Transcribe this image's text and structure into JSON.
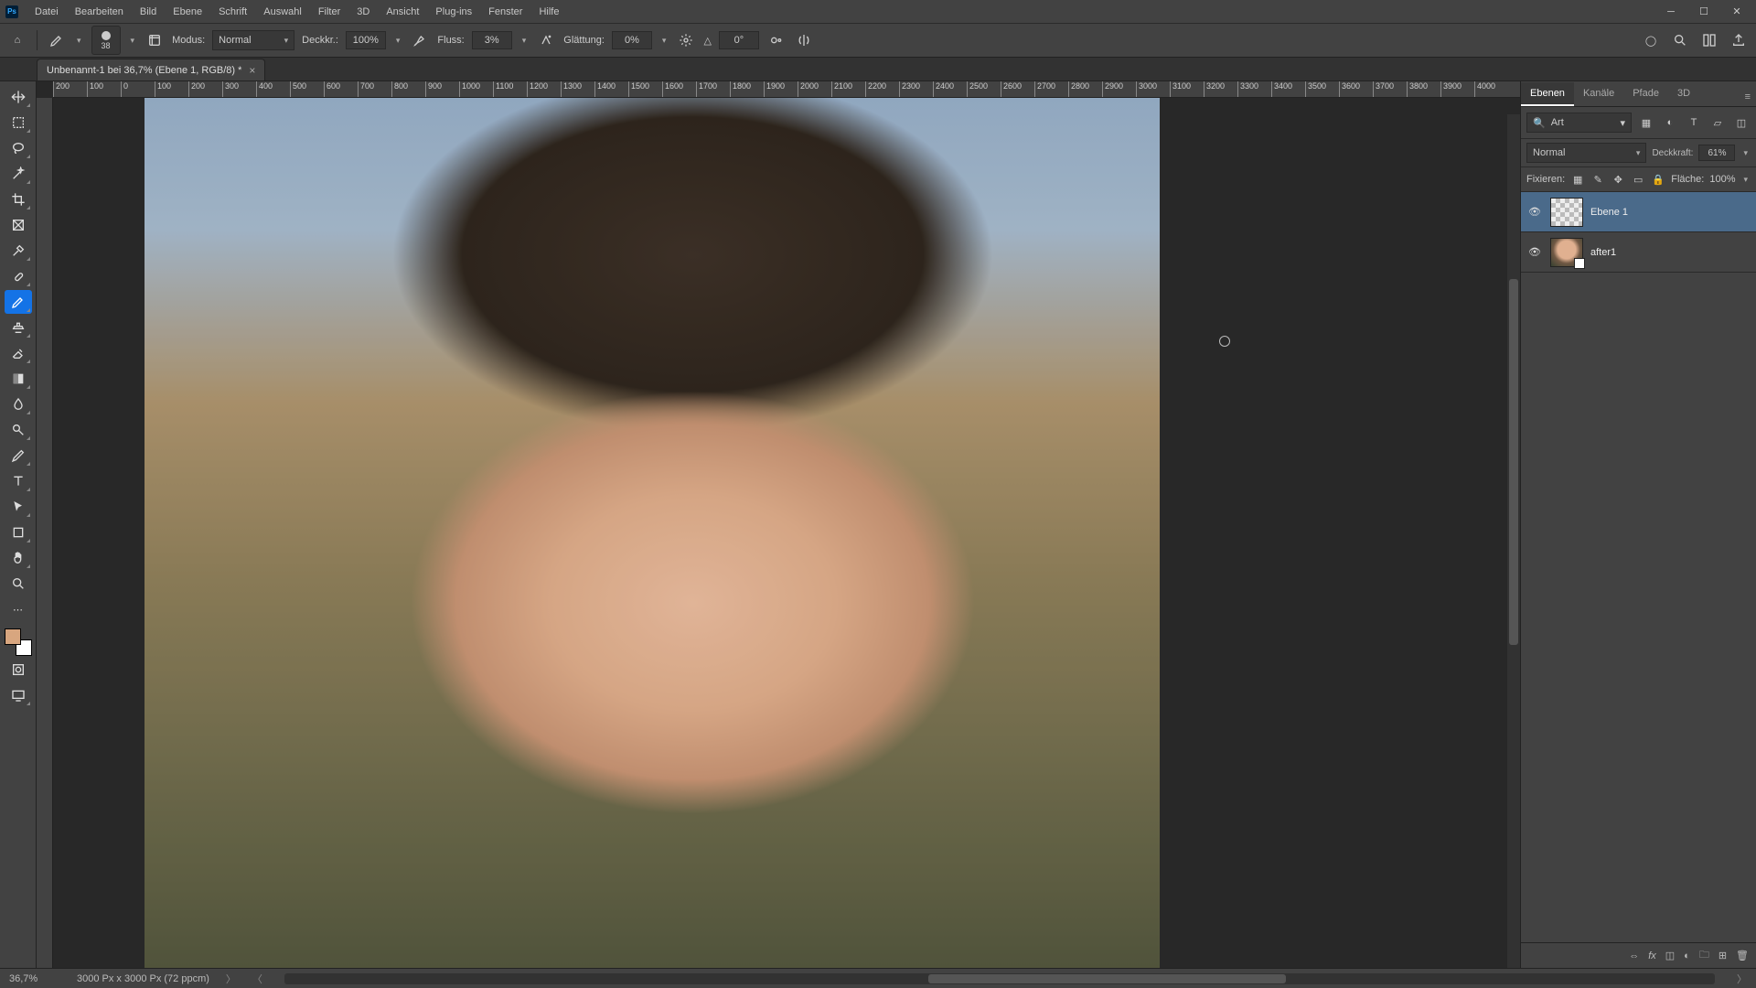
{
  "app": {
    "ps_badge": "Ps"
  },
  "menu": [
    "Datei",
    "Bearbeiten",
    "Bild",
    "Ebene",
    "Schrift",
    "Auswahl",
    "Filter",
    "3D",
    "Ansicht",
    "Plug-ins",
    "Fenster",
    "Hilfe"
  ],
  "options": {
    "brush_size": "38",
    "modus_label": "Modus:",
    "modus_value": "Normal",
    "deckkraft_label": "Deckkr.:",
    "deckkraft_value": "100%",
    "fluss_label": "Fluss:",
    "fluss_value": "3%",
    "glaettung_label": "Glättung:",
    "glaettung_value": "0%",
    "angle_icon": "△",
    "angle_value": "0°"
  },
  "document": {
    "tab_title": "Unbenannt-1 bei 36,7% (Ebene 1, RGB/8) *"
  },
  "ruler_ticks": [
    "200",
    "100",
    "0",
    "100",
    "200",
    "300",
    "400",
    "500",
    "600",
    "700",
    "800",
    "900",
    "1000",
    "1100",
    "1200",
    "1300",
    "1400",
    "1500",
    "1600",
    "1700",
    "1800",
    "1900",
    "2000",
    "2100",
    "2200",
    "2300",
    "2400",
    "2500",
    "2600",
    "2700",
    "2800",
    "2900",
    "3000",
    "3100",
    "3200",
    "3300",
    "3400",
    "3500",
    "3600",
    "3700",
    "3800",
    "3900",
    "4000"
  ],
  "panels": {
    "tabs": [
      "Ebenen",
      "Kanäle",
      "Pfade",
      "3D"
    ],
    "search_placeholder": "Art",
    "blend_mode": "Normal",
    "deckkraft_label": "Deckkraft:",
    "deckkraft_value": "61%",
    "fixieren_label": "Fixieren:",
    "flaeche_label": "Fläche:",
    "flaeche_value": "100%",
    "layers": [
      {
        "name": "Ebene 1",
        "thumb": "trans",
        "active": true
      },
      {
        "name": "after1",
        "thumb": "photo",
        "active": false,
        "has_mini": true
      }
    ]
  },
  "status": {
    "zoom": "36,7%",
    "doc_info": "3000 Px x 3000 Px (72 ppcm)"
  },
  "colors": {
    "foreground": "#d8a67f",
    "background": "#ffffff"
  }
}
